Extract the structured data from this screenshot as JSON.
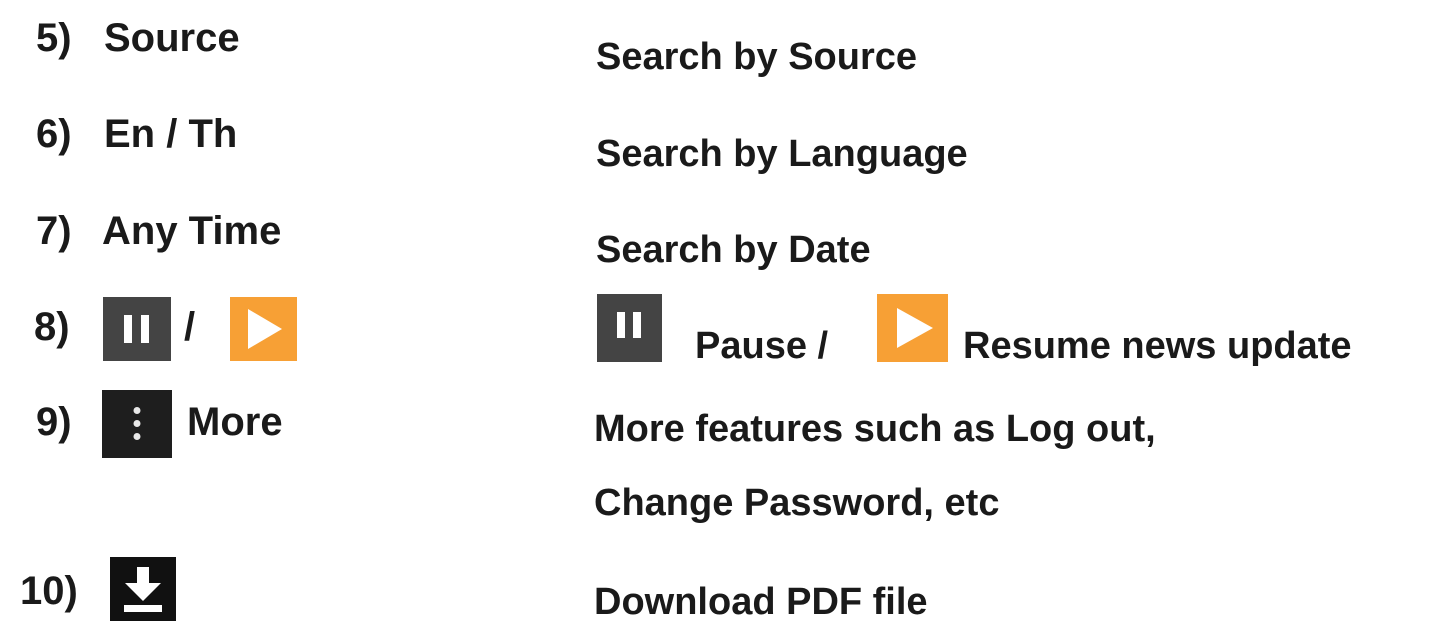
{
  "left_items": [
    {
      "number": "5)",
      "label": "Source"
    },
    {
      "number": "6)",
      "label": "En / Th"
    },
    {
      "number": "7)",
      "label": "Any Time"
    },
    {
      "number": "8)",
      "separator": "/"
    },
    {
      "number": "9)",
      "label": "More"
    },
    {
      "number": "10)"
    }
  ],
  "right_items": {
    "source": "Search by Source",
    "language": "Search by Language",
    "date": "Search by Date",
    "pause": "Pause /",
    "resume": "Resume news update",
    "more_line1": "More features such as Log out,",
    "more_line2": "Change Password, etc",
    "download": "Download PDF file"
  },
  "icons": {
    "pause": "pause-icon",
    "play": "play-icon",
    "more": "more-vertical-icon",
    "download": "download-icon"
  },
  "colors": {
    "text": "#1a1a1a",
    "pause_bg": "#444444",
    "play_bg": "#f7a035",
    "more_bg": "#1e1e1e",
    "download_bg": "#111111"
  }
}
